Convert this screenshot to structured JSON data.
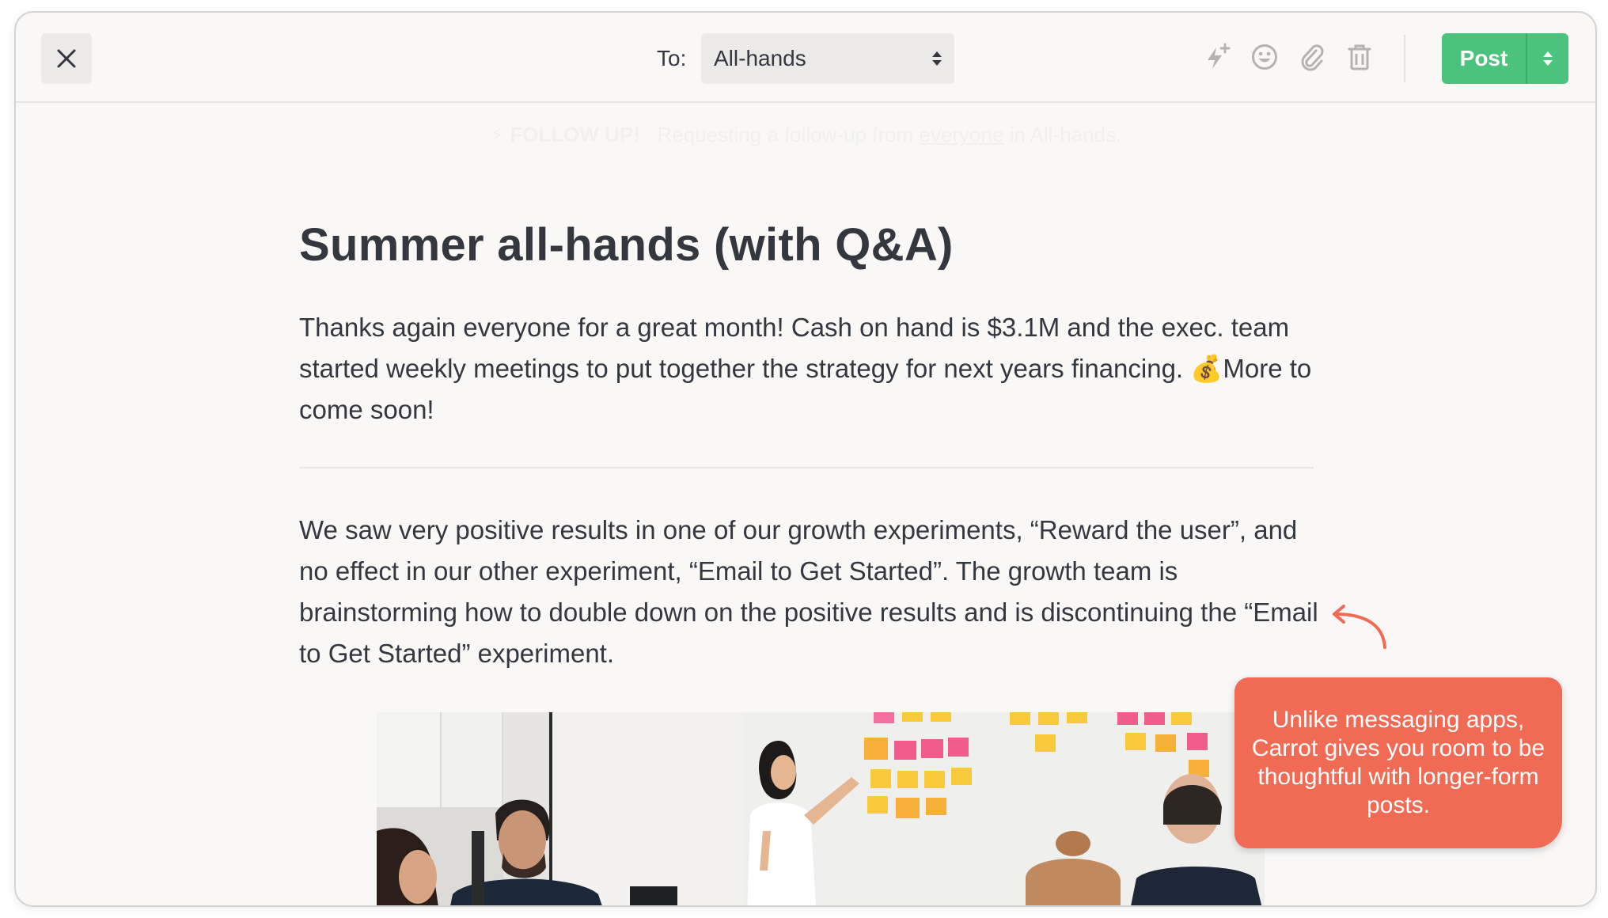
{
  "toolbar": {
    "to_label": "To:",
    "recipient": "All-hands",
    "icons": [
      "close-icon",
      "sparkle-bolt-icon",
      "emoji-icon",
      "paperclip-icon",
      "trash-icon",
      "chevron-updown-icon"
    ],
    "post_label": "Post"
  },
  "follow_up": {
    "tag": "FOLLOW UP!",
    "text_before": "Requesting a follow-up from",
    "link": "everyone",
    "text_after": "in All-hands."
  },
  "post": {
    "title": "Summer all-hands (with Q&A)",
    "paragraph1_before": "Thanks again everyone for a great month! Cash on hand is $3.1M and the exec. team started weekly meetings to put together the strategy for next years financing.",
    "paragraph1_emoji": "💰",
    "paragraph1_after": "More to come soon!",
    "paragraph2": "We saw very positive results in one of our growth experiments, “Reward the user”, and no effect in our other experiment, “Email to Get Started”. The growth team is brainstorming how to double down on the positive results and is discontinuing the “Email to Get Started” experiment."
  },
  "tooltip": {
    "text": "Unlike messaging apps, Carrot gives you room to be thoughtful with longer-form posts."
  },
  "colors": {
    "accent_green": "#4cc37d",
    "tooltip_red": "#f16a53",
    "text_dark": "#34383e",
    "background": "#f9f8f7"
  }
}
